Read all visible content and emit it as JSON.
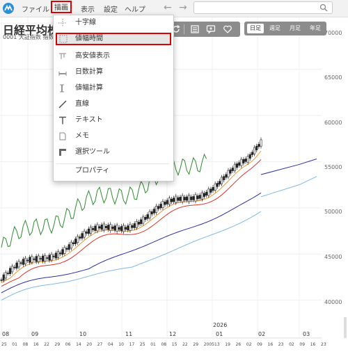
{
  "menubar": {
    "items": [
      {
        "label": "ファイル"
      },
      {
        "label": "描画"
      },
      {
        "label": "表示"
      },
      {
        "label": "設定"
      },
      {
        "label": "ヘルプ"
      }
    ],
    "back_arrow": "←",
    "forward_arrow": "→",
    "search_placeholder": ""
  },
  "header": {
    "title": "日経平均株",
    "subtitle": "0001 大証指数 指数"
  },
  "period_tabs": [
    {
      "label": "日足"
    },
    {
      "label": "週足"
    },
    {
      "label": "月足"
    },
    {
      "label": "年足"
    }
  ],
  "draw_menu": {
    "items": [
      {
        "label": "十字線",
        "icon": "crosshair-icon"
      },
      {
        "label": "値幅時間",
        "icon": "range-box-icon"
      },
      {
        "label": "高安値表示",
        "icon": "high-low-icon"
      },
      {
        "label": "日数計算",
        "icon": "day-count-icon"
      },
      {
        "label": "値幅計算",
        "icon": "price-range-icon"
      },
      {
        "label": "直線",
        "icon": "line-icon"
      },
      {
        "label": "テキスト",
        "icon": "text-icon"
      },
      {
        "label": "メモ",
        "icon": "memo-icon"
      },
      {
        "label": "選択ツール",
        "icon": "select-tool-icon"
      },
      {
        "label": "プロパティ",
        "icon": ""
      }
    ]
  },
  "chart_data": {
    "type": "candlestick",
    "y_axis": {
      "ticks": [
        "70000",
        "65000",
        "60000",
        "55000",
        "50000",
        "45000",
        "40000"
      ],
      "range": [
        35000,
        71000
      ]
    },
    "x_axis": {
      "year_label": "2026",
      "months": [
        "08",
        "09",
        "10",
        "11",
        "12",
        "01",
        "02",
        "03"
      ],
      "days": [
        "25",
        "01",
        "08",
        "16",
        "22",
        "29",
        "06",
        "14",
        "20",
        "27",
        "04",
        "10",
        "17",
        "25",
        "01",
        "08",
        "15",
        "22",
        "29",
        "2005",
        "13",
        "19",
        "26",
        "02",
        "09",
        "16",
        "23",
        "02",
        "09",
        "16",
        "23"
      ]
    },
    "colors": {
      "green_line": "#2f8a2f",
      "orange_line": "#e8962a",
      "red_line": "#d9332b",
      "navy_line": "#2b2f9e",
      "lightblue_line": "#7fb8e8"
    }
  }
}
